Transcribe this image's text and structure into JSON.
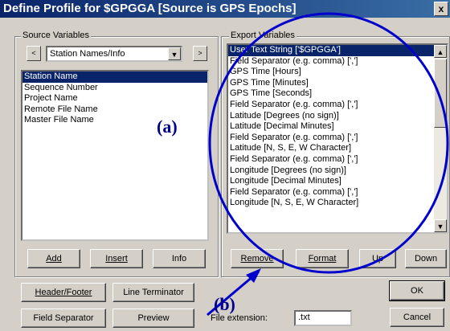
{
  "window": {
    "title": "Define Profile for $GPGGA [Source is GPS Epochs]",
    "close_label": "x"
  },
  "source": {
    "group_label": "Source Variables",
    "prev_label": "<",
    "next_label": ">",
    "combo_value": "Station Names/Info",
    "items": [
      "Station Name",
      "Sequence Number",
      "Project Name",
      "Remote File Name",
      "Master File Name"
    ],
    "selected_index": 0,
    "buttons": {
      "add": "Add",
      "insert": "Insert",
      "info": "Info"
    }
  },
  "export": {
    "group_label": "Export Variables",
    "items": [
      "User Text String ['$GPGGA']",
      "Field Separator (e.g. comma) [',']",
      "GPS Time [Hours]",
      "GPS Time [Minutes]",
      "GPS Time [Seconds]",
      "Field Separator (e.g. comma) [',']",
      "Latitude [Degrees (no sign)]",
      "Latitude [Decimal Minutes]",
      "Field Separator (e.g. comma) [',']",
      "Latitude [N, S, E, W Character]",
      "Field Separator (e.g. comma) [',']",
      "Longitude [Degrees (no sign)]",
      "Longitude [Decimal Minutes]",
      "Field Separator (e.g. comma) [',']",
      "Longitude [N, S, E, W Character]"
    ],
    "selected_index": 0,
    "buttons": {
      "remove": "Remove",
      "format": "Format",
      "up": "Up",
      "down": "Down"
    }
  },
  "bottom": {
    "header_footer": "Header/Footer",
    "line_terminator": "Line Terminator",
    "field_separator": "Field Separator",
    "preview": "Preview",
    "file_ext_label": "File extension:",
    "file_ext_value": ".txt",
    "ok": "OK",
    "cancel": "Cancel"
  },
  "annotations": {
    "a": "(a)",
    "b": "(b)",
    "color": "#0000cc"
  }
}
